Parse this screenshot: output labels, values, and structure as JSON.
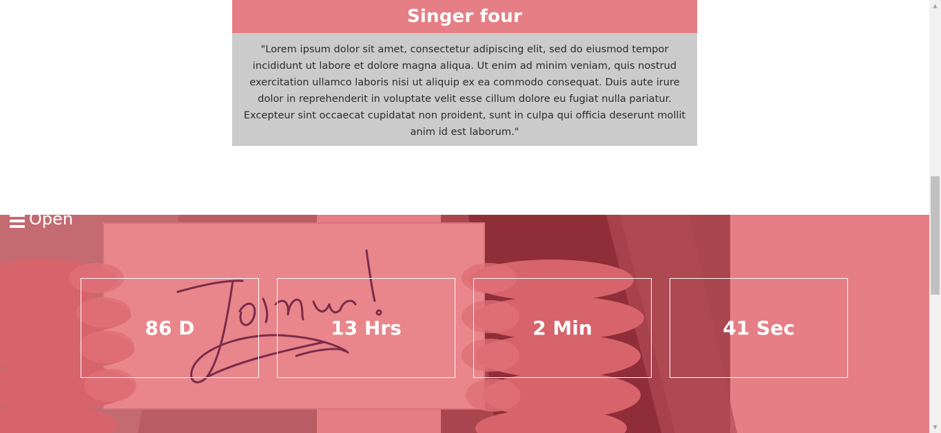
{
  "card": {
    "title": "Singer four",
    "quote": "\"Lorem ipsum dolor sit amet, consectetur adipiscing elit, sed do eiusmod tempor incididunt ut labore et dolore magna aliqua. Ut enim ad minim veniam, quis nostrud exercitation ullamco laboris nisi ut aliquip ex ea commodo consequat. Duis aute irure dolor in reprehenderit in voluptate velit esse cillum dolore eu fugiat nulla pariatur. Excepteur sint occaecat cupidatat non proident, sunt in culpa qui officia deserunt mollit anim id est laborum.\""
  },
  "nav": {
    "open_label": "Open",
    "icon": "hamburger-icon"
  },
  "countdown": {
    "days": "86 D",
    "hours": "13 Hrs",
    "minutes": "2 Min",
    "seconds": "41 Sec"
  },
  "hero": {
    "handwriting_image_text": "Join us!"
  },
  "colors": {
    "accent": "#e57f85",
    "card_body": "#cbcbcb",
    "text_dark": "#2b2b2b"
  }
}
